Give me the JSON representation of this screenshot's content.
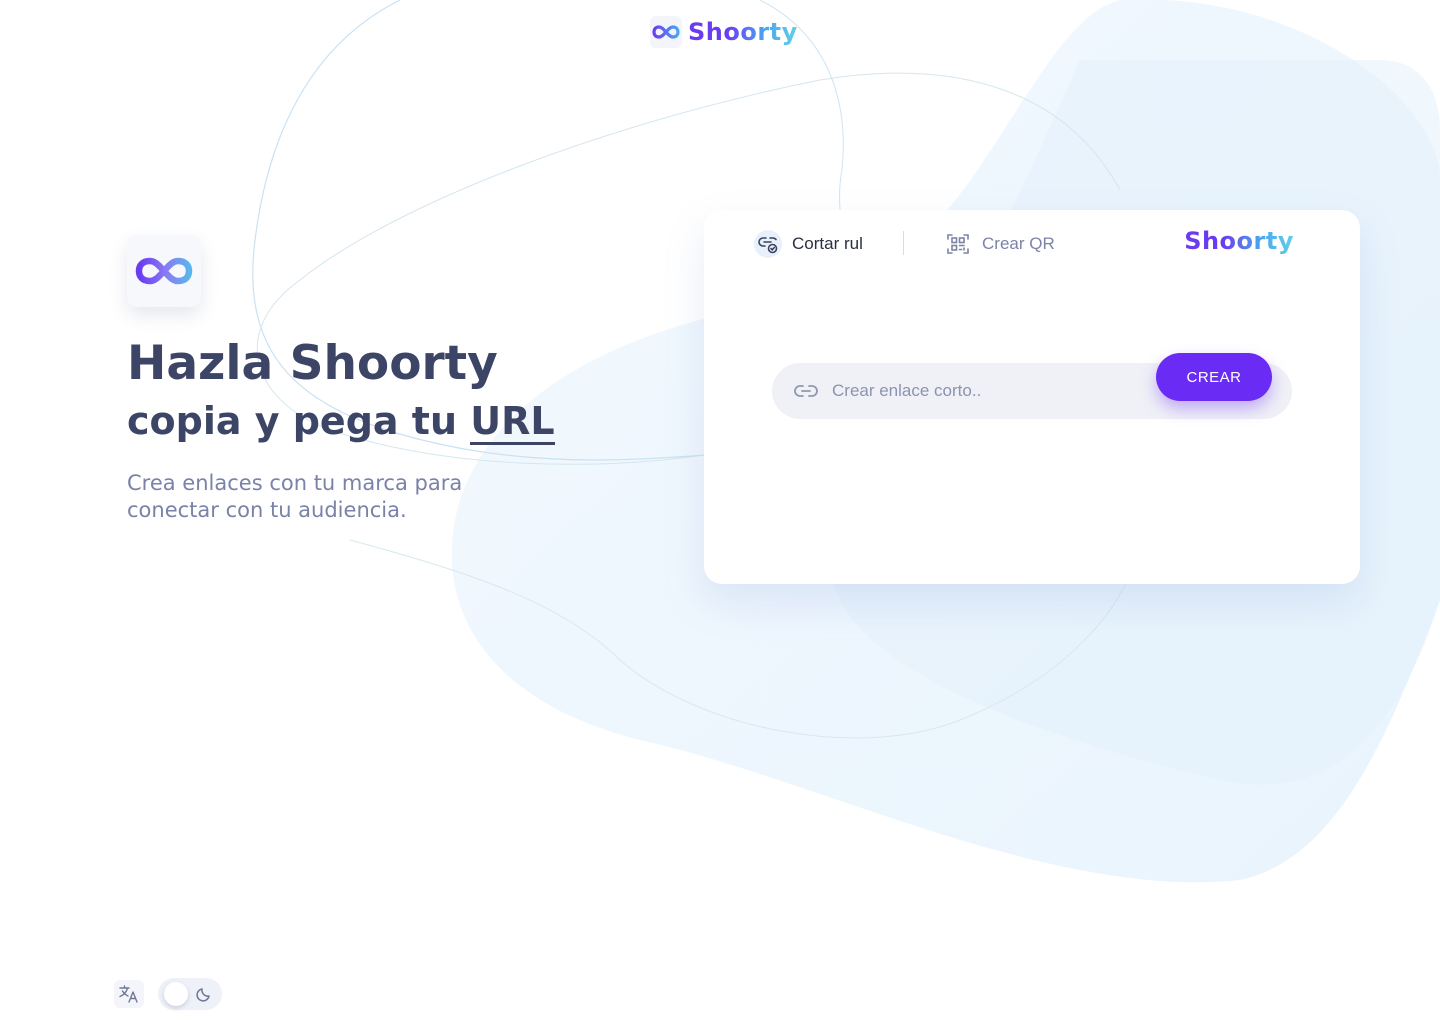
{
  "brand": {
    "name": "Shoorty"
  },
  "hero": {
    "title": "Hazla Shoorty",
    "subtitle_prefix": "copia y pega tu",
    "subtitle_emphasis": "URL",
    "description": "Crea enlaces con tu marca para conectar con tu audiencia."
  },
  "card": {
    "tabs": [
      {
        "label": "Cortar rul",
        "icon": "link-shorten-icon",
        "active": true
      },
      {
        "label": "Crear QR",
        "icon": "qr-scan-icon",
        "active": false
      }
    ],
    "input": {
      "placeholder": "Crear enlace corto..",
      "value": ""
    },
    "create_button": "CREAR"
  },
  "footer": {
    "language_icon": "translate-icon",
    "theme_icon": "moon-icon",
    "dark_mode": false
  },
  "colors": {
    "accent": "#6a2cf5",
    "text_primary": "#3d4566",
    "text_muted": "#7a82a8",
    "brand_gradient_start": "#6a3cf0",
    "brand_gradient_end": "#62d0e6",
    "background_blob": "#eaf4fd"
  }
}
